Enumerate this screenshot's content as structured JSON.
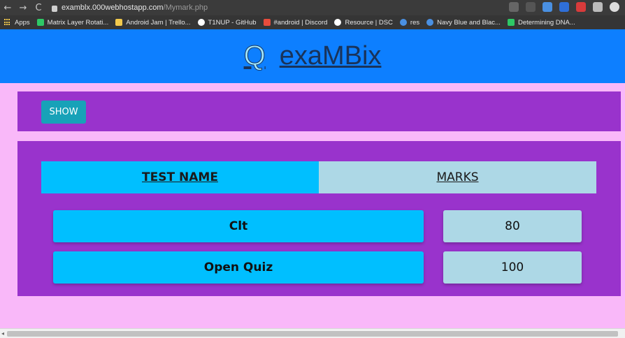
{
  "browser": {
    "url_host": "examblx.000webhostapp.com",
    "url_path": "/Mymark.php",
    "nav": {
      "back": "←",
      "forward": "→",
      "reload": "C"
    },
    "bookmarks": [
      {
        "label": "Apps",
        "icon": "apps-grid-icon",
        "color": "#f2c94c"
      },
      {
        "label": "Matrix Layer Rotati...",
        "icon": "hackerrank-icon",
        "color": "#2ec866"
      },
      {
        "label": "Android Jam | Trello...",
        "icon": "trello-icon",
        "color": "#f2c94c"
      },
      {
        "label": "T1NUP - GitHub",
        "icon": "github-icon",
        "color": "#ffffff"
      },
      {
        "label": "#android | Discord",
        "icon": "discord-icon",
        "color": "#e74c3c"
      },
      {
        "label": "Resource | DSC",
        "icon": "github-icon",
        "color": "#ffffff"
      },
      {
        "label": "res",
        "icon": "chrome-icon",
        "color": "#4a90e2"
      },
      {
        "label": "Navy Blue and Blac...",
        "icon": "chrome-icon",
        "color": "#4a90e2"
      },
      {
        "label": "Determining DNA...",
        "icon": "hackerrank-icon",
        "color": "#2ec866"
      }
    ]
  },
  "app": {
    "brand_icon": "Q",
    "brand_name": "exaMBix"
  },
  "controls": {
    "show_label": "SHOW"
  },
  "table": {
    "headers": {
      "name": "TEST NAME",
      "marks": "MARKS"
    },
    "rows": [
      {
        "name": "Clt",
        "marks": "80"
      },
      {
        "name": "Open Quiz",
        "marks": "100"
      }
    ]
  }
}
